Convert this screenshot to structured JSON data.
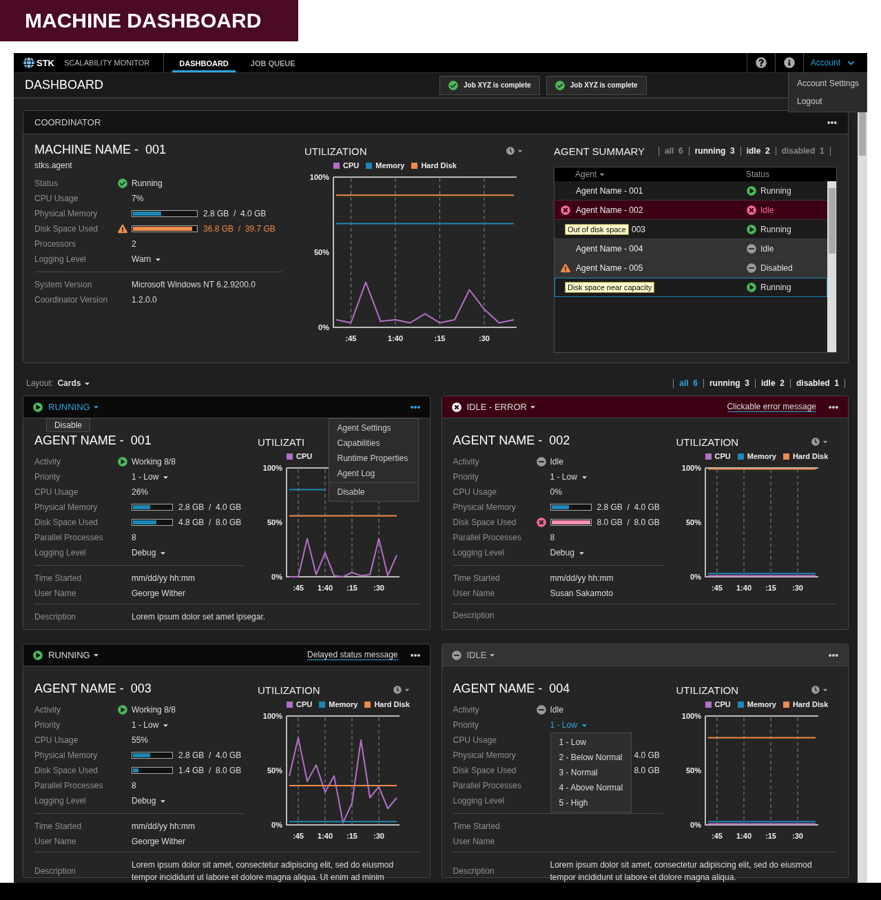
{
  "banner": {
    "title": "MACHINE DASHBOARD"
  },
  "nav": {
    "logo": "STK",
    "app_name": "SCALABILITY MONITOR",
    "tabs": [
      {
        "label": "DASHBOARD",
        "selected": true
      },
      {
        "label": "JOB QUEUE",
        "selected": false
      }
    ],
    "account": {
      "label": "Account",
      "expanded": true,
      "menu": [
        "Account Settings",
        "Logout"
      ]
    }
  },
  "page": {
    "title": "DASHBOARD",
    "notifications": [
      "Job XYZ is complete",
      "Job XYZ is complete"
    ]
  },
  "coordinator": {
    "title": "COORDINATOR",
    "machine": {
      "name": "MACHINE NAME -  001",
      "subtitle": "stks.agent",
      "rows": [
        {
          "label": "Status",
          "kind": "status",
          "icon": {
            "kind": "ok"
          },
          "value": "Running"
        },
        {
          "label": "CPU Usage",
          "kind": "text",
          "value": "7%"
        },
        {
          "label": "Physical Memory",
          "kind": "bar",
          "meter": {
            "kind": "normal",
            "level": 0.45
          },
          "reading": "2.8 GB  /  4.0 GB"
        },
        {
          "label": "Disk Space Used",
          "kind": "bar",
          "meter": {
            "kind": "warning",
            "level": 0.93
          },
          "reading": "36.8 GB  /  39.7 GB"
        },
        {
          "label": "Processors",
          "kind": "text",
          "value": "2"
        },
        {
          "label": "Logging Level",
          "kind": "select",
          "value": "Warn",
          "expanded": false
        }
      ],
      "details": [
        {
          "label": "System Version",
          "value": "Microsoft Windows NT 6.2.9200.0"
        },
        {
          "label": "Coordinator Version",
          "value": "1.2.0.0"
        }
      ]
    },
    "utilization": {
      "clock": true,
      "chart_data": {
        "type": "line",
        "grid": true,
        "title": "UTILIZATION",
        "categories": [
          null,
          ":45",
          null,
          null,
          "1:40",
          null,
          null,
          ":15",
          null,
          null,
          ":30",
          null,
          null
        ],
        "ylim": [
          0,
          100
        ],
        "yticks": [
          {
            "value": 0,
            "label": "0%"
          },
          {
            "value": 50,
            "label": "50%"
          },
          {
            "value": 100,
            "label": "100%"
          }
        ],
        "series": [
          {
            "name": "CPU",
            "color": "#b46fc8",
            "values": [
              5,
              3,
              30,
              4,
              5,
              3,
              9,
              3,
              5,
              25,
              12,
              3,
              5
            ]
          },
          {
            "name": "Memory",
            "color": "#1c87b6",
            "values": [
              69,
              69,
              69,
              69,
              69,
              69,
              69,
              69,
              69,
              69,
              69,
              69,
              69
            ]
          },
          {
            "name": "Hard Disk",
            "color": "#f08a4b",
            "values": [
              88,
              88,
              88,
              88,
              88,
              88,
              88,
              88,
              88,
              88,
              88,
              88,
              88
            ]
          }
        ]
      }
    },
    "summary": {
      "title": "AGENT SUMMARY",
      "filters": [
        {
          "label": "all  6",
          "muted": true
        },
        {
          "label": "running  3",
          "muted": false
        },
        {
          "label": "idle  2",
          "muted": false
        },
        {
          "label": "disabled  1",
          "muted": true
        }
      ],
      "columns": [
        "Agent",
        "Status"
      ],
      "rows": [
        {
          "name": "Agent Name - 001",
          "status": {
            "kind": "running",
            "label": "Running"
          },
          "selected": false
        },
        {
          "alert": {
            "kind": "error"
          },
          "name": "Agent Name - 002",
          "status": {
            "kind": "error",
            "label": "Idle"
          },
          "selected": false
        },
        {
          "tooltip": "Out of disk space",
          "name": "003",
          "status": {
            "kind": "running",
            "label": "Running"
          },
          "selected": false
        },
        {
          "name": "Agent Name - 004",
          "status": {
            "kind": "idle",
            "label": "Idle"
          },
          "selected": false
        },
        {
          "alert": {
            "kind": "warning"
          },
          "name": "Agent Name - 005",
          "status": {
            "kind": "disabled",
            "label": "Disabled"
          },
          "selected": false
        },
        {
          "tooltip": "Disk space near capacity",
          "status": {
            "kind": "running",
            "label": "Running"
          },
          "selected": true
        }
      ]
    }
  },
  "layout_bar": {
    "label": "Layout:",
    "value": "Cards",
    "filters": [
      {
        "label": "all  6",
        "selected": true
      },
      {
        "label": "running  3",
        "selected": false
      },
      {
        "label": "idle  2",
        "selected": false
      },
      {
        "label": "disabled  1",
        "selected": false
      }
    ]
  },
  "cards": [
    {
      "status": {
        "kind": "running",
        "label": "RUNNING",
        "highlighted": true
      },
      "status_menu": [
        "Disable"
      ],
      "menu": [
        {
          "items": [
            "Agent Settings",
            "Capabilities",
            "Runtime Properties",
            "Agent Log"
          ]
        },
        {
          "items": [
            "Disable"
          ]
        }
      ],
      "name": "AGENT NAME -  001",
      "rows": [
        {
          "label": "Activity",
          "kind": "status",
          "icon": {
            "kind": "running"
          },
          "value": "Working 8/8"
        },
        {
          "label": "Priority",
          "kind": "select",
          "value": "1 - Low",
          "expanded": false
        },
        {
          "label": "CPU Usage",
          "kind": "text",
          "value": "26%"
        },
        {
          "label": "Physical Memory",
          "kind": "bar",
          "meter": {
            "kind": "normal",
            "level": 0.45
          },
          "reading": "2.8 GB  /  4.0 GB"
        },
        {
          "label": "Disk Space Used",
          "kind": "bar",
          "meter": {
            "kind": "normal",
            "level": 0.6
          },
          "reading": "4.8 GB  /  8.0 GB"
        },
        {
          "label": "Parallel Processes",
          "kind": "text",
          "value": "8"
        },
        {
          "label": "Logging Level",
          "kind": "select",
          "value": "Debug",
          "expanded": false
        }
      ],
      "details": [
        {
          "label": "Time Started",
          "value": "mm/dd/yy hh:mm"
        },
        {
          "label": "User Name",
          "value": "George Wither"
        }
      ],
      "description": {
        "label": "Description",
        "value": "Lorem ipsum dolor set amet ipsegar."
      },
      "utilization": {
        "clock": false,
        "chart_data": {
          "type": "line",
          "grid": true,
          "title": "UTILIZATI",
          "categories": [
            null,
            ":45",
            null,
            null,
            "1:40",
            null,
            null,
            ":15",
            null,
            null,
            ":30",
            null,
            null
          ],
          "ylim": [
            0,
            100
          ],
          "yticks": [
            {
              "value": 0,
              "label": "0%"
            },
            {
              "value": 50,
              "label": "50%"
            },
            {
              "value": 100,
              "label": "100%"
            }
          ],
          "series": [
            {
              "name": "CPU",
              "color": "#b46fc8",
              "values": [
                0,
                0,
                35,
                2,
                22,
                1,
                0,
                4,
                1,
                2,
                35,
                1,
                20
              ]
            },
            {
              "color": "#1c87b6",
              "values": [
                80,
                80,
                80,
                80,
                80,
                null,
                null,
                null,
                null,
                null,
                null,
                null,
                null
              ]
            },
            {
              "color": "#f08a4b",
              "values": [
                56,
                56,
                56,
                56,
                56,
                56,
                56,
                56,
                56,
                56,
                56,
                56,
                56
              ]
            }
          ]
        }
      }
    },
    {
      "status": {
        "kind": "error",
        "label": "IDLE - ERROR",
        "highlighted": false
      },
      "message": "Clickable error message",
      "name": "AGENT NAME -  002",
      "rows": [
        {
          "label": "Activity",
          "kind": "status",
          "icon": {
            "kind": "idle"
          },
          "value": "Idle"
        },
        {
          "label": "Priority",
          "kind": "select",
          "value": "1 - Low",
          "expanded": false
        },
        {
          "label": "CPU Usage",
          "kind": "text",
          "value": "0%"
        },
        {
          "label": "Physical Memory",
          "kind": "bar",
          "meter": {
            "kind": "normal",
            "level": 0.45
          },
          "reading": "2.8 GB  /  4.0 GB"
        },
        {
          "label": "Disk Space Used",
          "kind": "bar",
          "meter": {
            "kind": "error",
            "level": 1
          },
          "reading": "8.0 GB  /  8.0 GB"
        },
        {
          "label": "Parallel Processes",
          "kind": "text",
          "value": "8"
        },
        {
          "label": "Logging Level",
          "kind": "select",
          "value": "Debug",
          "expanded": false
        }
      ],
      "details": [
        {
          "label": "Time Started",
          "value": "mm/dd/yy hh:mm"
        },
        {
          "label": "User Name",
          "value": "Susan Sakamoto"
        }
      ],
      "description": {
        "label": "Description"
      },
      "utilization": {
        "clock": true,
        "chart_data": {
          "type": "line",
          "grid": true,
          "title": "UTILIZATION",
          "categories": [
            null,
            ":45",
            null,
            null,
            "1:40",
            null,
            null,
            ":15",
            null,
            null,
            ":30",
            null,
            null
          ],
          "ylim": [
            0,
            100
          ],
          "yticks": [
            {
              "value": 0,
              "label": "0%"
            },
            {
              "value": 50,
              "label": "50%"
            },
            {
              "value": 100,
              "label": "100%"
            }
          ],
          "series": [
            {
              "name": "CPU",
              "color": "#b46fc8",
              "values": [
                1,
                1,
                1,
                1,
                1,
                1,
                1,
                1,
                1,
                1,
                1,
                1,
                1
              ]
            },
            {
              "name": "Memory",
              "color": "#1c87b6",
              "values": [
                3,
                3,
                3,
                3,
                3,
                3,
                3,
                3,
                3,
                3,
                3,
                3,
                3
              ]
            },
            {
              "name": "Hard Disk",
              "color": "#f08a4b",
              "values": [
                99,
                99,
                99,
                99,
                99,
                99,
                99,
                99,
                99,
                99,
                99,
                99,
                99
              ]
            }
          ]
        }
      }
    },
    {
      "status": {
        "kind": "running",
        "label": "RUNNING",
        "highlighted": false
      },
      "message": "Delayed status message",
      "name": "AGENT NAME -  003",
      "rows": [
        {
          "label": "Activity",
          "kind": "status",
          "icon": {
            "kind": "running"
          },
          "value": "Working 8/8"
        },
        {
          "label": "Priority",
          "kind": "select",
          "value": "1 - Low",
          "expanded": false
        },
        {
          "label": "CPU Usage",
          "kind": "text",
          "value": "55%"
        },
        {
          "label": "Physical Memory",
          "kind": "bar",
          "meter": {
            "kind": "normal",
            "level": 0.45
          },
          "reading": "2.8 GB  /  4.0 GB"
        },
        {
          "label": "Disk Space Used",
          "kind": "bar",
          "meter": {
            "kind": "normal",
            "level": 0.15
          },
          "reading": "1.4 GB  /  8.0 GB"
        },
        {
          "label": "Parallel Processes",
          "kind": "text",
          "value": "8"
        },
        {
          "label": "Logging Level",
          "kind": "select",
          "value": "Debug",
          "expanded": false
        }
      ],
      "details": [
        {
          "label": "Time Started",
          "value": "mm/dd/yy hh:mm"
        },
        {
          "label": "User Name",
          "value": "George Wither"
        }
      ],
      "description": {
        "label": "Description",
        "value": "Lorem ipsum dolor sit amet, consectetur adipiscing elit, sed do eiusmod tempor incididunt ut labore et dolore magna aliqua. Ut enim ad minim"
      },
      "utilization": {
        "clock": true,
        "chart_data": {
          "type": "line",
          "grid": true,
          "title": "UTILIZATION",
          "categories": [
            null,
            ":45",
            null,
            null,
            "1:40",
            null,
            null,
            ":15",
            null,
            null,
            ":30",
            null,
            null
          ],
          "ylim": [
            0,
            100
          ],
          "yticks": [
            {
              "value": 0,
              "label": "0%"
            },
            {
              "value": 50,
              "label": "50%"
            },
            {
              "value": 100,
              "label": "100%"
            }
          ],
          "series": [
            {
              "name": "CPU",
              "color": "#b46fc8",
              "values": [
                45,
                80,
                40,
                55,
                30,
                45,
                2,
                20,
                78,
                25,
                35,
                15,
                25
              ]
            },
            {
              "name": "Memory",
              "color": "#1c87b6",
              "values": [
                3,
                3,
                3,
                3,
                3,
                3,
                3,
                3,
                3,
                3,
                3,
                3,
                3
              ]
            },
            {
              "name": "Hard Disk",
              "color": "#f08a4b",
              "values": [
                36,
                36,
                36,
                36,
                36,
                36,
                36,
                36,
                36,
                36,
                36,
                36,
                36
              ]
            }
          ]
        }
      }
    },
    {
      "status": {
        "kind": "idle",
        "label": "IDLE",
        "highlighted": false
      },
      "name": "AGENT NAME -  004",
      "rows": [
        {
          "label": "Activity",
          "kind": "status",
          "icon": {
            "kind": "idle"
          },
          "value": "Idle"
        },
        {
          "label": "Priority",
          "kind": "select",
          "value": "1 - Low",
          "expanded": true,
          "options": [
            "1 - Low",
            "2 - Below Normal",
            "3 - Normal",
            "4 - Above Normal",
            "5 - High"
          ]
        },
        {
          "label": "CPU Usage",
          "kind": "text"
        },
        {
          "label": "Physical Memory",
          "kind": "bar",
          "reading": "4.0 GB"
        },
        {
          "label": "Disk Space Used",
          "kind": "bar",
          "reading": "8.0 GB"
        },
        {
          "label": "Parallel Processes",
          "kind": "text"
        },
        {
          "label": "Logging Level",
          "kind": "text"
        }
      ],
      "details": [
        {
          "label": "Time Started"
        },
        {
          "label": "User Name"
        }
      ],
      "description": {
        "label": "Description",
        "value": "Lorem ipsum dolor sit amet, consectetur adipiscing elit, sed do eiusmod tempor incididunt ut labore et dolore magna aliqua."
      },
      "utilization": {
        "clock": true,
        "chart_data": {
          "type": "line",
          "grid": true,
          "title": "UTILIZATION",
          "categories": [
            null,
            ":45",
            null,
            null,
            "1:40",
            null,
            null,
            ":15",
            null,
            null,
            ":30",
            null,
            null
          ],
          "ylim": [
            0,
            100
          ],
          "yticks": [
            {
              "value": 0,
              "label": "0%"
            },
            {
              "value": 50,
              "label": "50%"
            },
            {
              "value": 100,
              "label": "100%"
            }
          ],
          "series": [
            {
              "name": "CPU",
              "color": "#b46fc8",
              "values": [
                1,
                1,
                1,
                1,
                1,
                1,
                1,
                1,
                1,
                1,
                1,
                1,
                1
              ]
            },
            {
              "name": "Memory",
              "color": "#1c87b6",
              "values": [
                3,
                3,
                3,
                3,
                3,
                3,
                3,
                3,
                3,
                3,
                3,
                3,
                3
              ]
            },
            {
              "name": "Hard Disk",
              "color": "#f08a4b",
              "values": [
                80,
                80,
                80,
                80,
                80,
                80,
                80,
                80,
                80,
                80,
                80,
                80,
                80
              ]
            }
          ]
        }
      }
    }
  ]
}
